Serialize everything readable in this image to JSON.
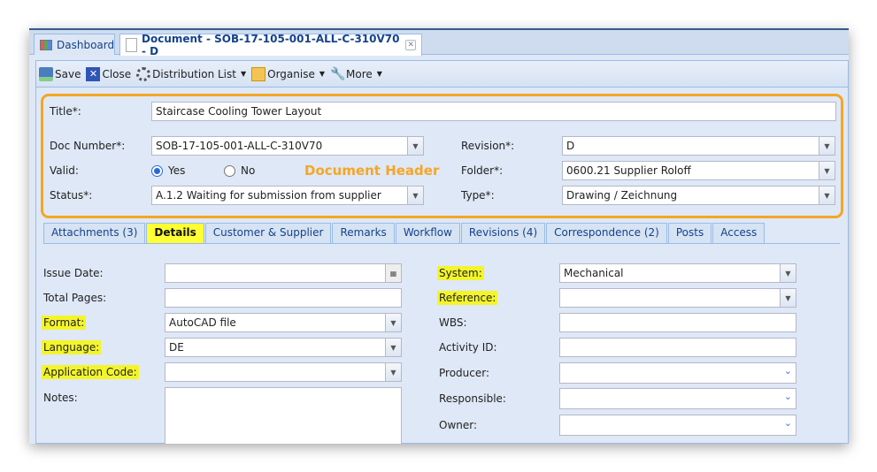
{
  "window_tabs": [
    {
      "label": "Dashboard"
    },
    {
      "label": "Document - SOB-17-105-001-ALL-C-310V70 - D"
    }
  ],
  "toolbar": {
    "save": "Save",
    "close": "Close",
    "distribution": "Distribution List",
    "organise": "Organise",
    "more": "More"
  },
  "header": {
    "annotation": "Document Header",
    "title_label": "Title*:",
    "title_value": "Staircase Cooling Tower Layout",
    "docnum_label": "Doc Number*:",
    "docnum_value": "SOB-17-105-001-ALL-C-310V70",
    "valid_label": "Valid:",
    "yes": "Yes",
    "no": "No",
    "valid_selected": "Yes",
    "status_label": "Status*:",
    "status_value": "A.1.2 Waiting for submission from supplier",
    "revision_label": "Revision*:",
    "revision_value": "D",
    "folder_label": "Folder*:",
    "folder_value": "0600.21 Supplier Roloff",
    "type_label": "Type*:",
    "type_value": "Drawing / Zeichnung"
  },
  "tabs": [
    "Attachments (3)",
    "Details",
    "Customer & Supplier",
    "Remarks",
    "Workflow",
    "Revisions (4)",
    "Correspondence (2)",
    "Posts",
    "Access"
  ],
  "active_tab": "Details",
  "details": {
    "issue_date": "Issue Date:",
    "total_pages": "Total Pages:",
    "format": "Format:",
    "format_value": "AutoCAD file",
    "language": "Language:",
    "language_value": "DE",
    "app_code": "Application Code:",
    "notes": "Notes:",
    "system": "System:",
    "system_value": "Mechanical",
    "reference": "Reference:",
    "wbs": "WBS:",
    "activity": "Activity ID:",
    "producer": "Producer:",
    "responsible": "Responsible:",
    "owner": "Owner:"
  },
  "colors": {
    "highlight": "#f3f52a",
    "header_border": "#f5a623"
  }
}
